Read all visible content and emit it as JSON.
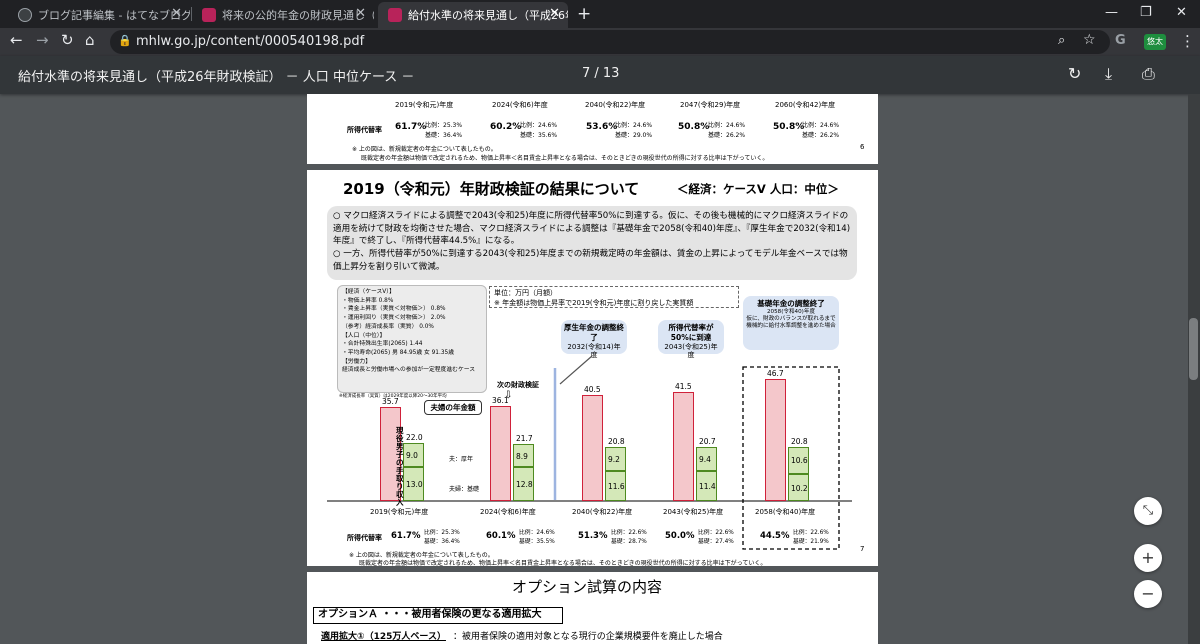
{
  "tabs": [
    {
      "title": "ブログ記事編集 - はてなブログ",
      "active": false
    },
    {
      "title": "将来の公的年金の財政見通し（財",
      "active": false
    },
    {
      "title": "給付水準の将来見通し（平成26年",
      "active": true
    }
  ],
  "new_tab": "+",
  "window": {
    "minimize": "—",
    "restore": "❐",
    "close": "✕"
  },
  "address": {
    "url": "mhlw.go.jp/content/000540198.pdf",
    "profile": "悠太"
  },
  "pdf": {
    "title": "給付水準の将来見通し（平成26年財政検証） － 人口 中位ケース －",
    "page": "7 / 13"
  },
  "prev_page": {
    "years": [
      "2019(令和元)年度",
      "2024(令和6)年度",
      "2040(令和22)年度",
      "2047(令和29)年度",
      "2060(令和42)年度"
    ],
    "label": "所得代替率",
    "rates": [
      "61.7%",
      "60.2%",
      "53.6%",
      "50.8%",
      "50.8%"
    ],
    "hirei": [
      "比例：25.3%",
      "比例：24.6%",
      "比例：24.6%",
      "比例：24.6%",
      "比例：24.6%"
    ],
    "kiso": [
      "基礎：36.4%",
      "基礎：35.6%",
      "基礎：29.0%",
      "基礎：26.2%",
      "基礎：26.2%"
    ],
    "note1": "※ 上の図は、新規裁定者の年金について表したもの。",
    "note2": "既裁定者の年金額は物価で改定されるため、物価上昇率＜名目賃金上昇率となる場合は、そのときどきの現役世代の所得に対する比率は下がっていく。",
    "num": "6"
  },
  "slide": {
    "title": "2019（令和元）年財政検証の結果について",
    "subtitle": "＜経済：ケースⅤ 人口：中位＞",
    "bullet1": "○ マクロ経済スライドによる調整で2043(令和25)年度に所得代替率50%に到達する。仮に、その後も機械的にマクロ経済スライドの適用を続けて財政を均衡させた場合、マクロ経済スライドによる調整は『基礎年金で2058(令和40)年度』、『厚生年金で2032(令和14)年度』で終了し、『所得代替率44.5%』になる。",
    "bullet2": "○ 一方、所得代替率が50%に到達する2043(令和25)年度までの新規裁定時の年金額は、賃金の上昇によってモデル年金ベースでは物価上昇分を割り引いて微減。",
    "assump": [
      "【経済（ケースⅤ）】",
      "・物価上昇率  0.8%",
      "・賃金上昇率（実質＜対物価＞） 0.8%",
      "・運用利回り（実質＜対物価＞） 2.0%",
      "（参考）経済成長率（実質） 0.0%",
      "【人口（中位）】",
      "・合計特殊出生率(2065)  1.44",
      "・平均寿命(2065) 男 84.95歳 女 91.35歳",
      "【労働力】",
      "経済成長と労働市場への参加が一定程度進むケース"
    ],
    "footnote_small": "※経済成長率（実質）は2029年度以降20～30年平均",
    "unit": "単位：万円（月額）",
    "unit_note": "※ 年金額は物価上昇率で2019(令和元)年度に割り戻した実質額",
    "callouts": [
      {
        "title": "厚生年金の調整終了",
        "sub": "2032(令和14)年度"
      },
      {
        "title": "所得代替率が50%に到達",
        "sub": "2043(令和25)年度"
      },
      {
        "title": "基礎年金の調整終了",
        "sub": "2058(令和40)年度",
        "note": "仮に、財政のバランスが取れるまで機械的に給付水準調整を進めた場合"
      }
    ],
    "next_check": "次の財政検証",
    "couple_label": "夫婦の年金額",
    "worker_label": "現役男子の手取り収入",
    "husband_label": "夫：厚年",
    "couple_kiso_label": "夫婦：基礎",
    "footer_label": "所得代替率",
    "footer_note1": "※ 上の図は、新規裁定者の年金について表したもの。",
    "footer_note2": "既裁定者の年金額は物価で改定されるため、物価上昇率＜名目賃金上昇率となる場合は、そのときどきの現役世代の所得に対する比率は下がっていく。",
    "page_num": "7"
  },
  "chart_data": {
    "type": "bar",
    "categories": [
      "2019(令和元)年度",
      "2024(令和6)年度",
      "2040(令和22)年度",
      "2043(令和25)年度",
      "2058(令和40)年度"
    ],
    "series": [
      {
        "name": "現役男子の手取り収入",
        "values": [
          35.7,
          36.1,
          40.5,
          41.5,
          46.7
        ]
      },
      {
        "name": "夫婦の年金額",
        "values": [
          22.0,
          21.7,
          20.8,
          20.7,
          20.8
        ]
      },
      {
        "name": "夫：厚年",
        "values": [
          9.0,
          8.9,
          9.2,
          9.4,
          10.6
        ]
      },
      {
        "name": "夫婦：基礎",
        "values": [
          13.0,
          12.8,
          11.6,
          11.4,
          10.2
        ]
      }
    ],
    "rates": [
      "61.7%",
      "60.1%",
      "51.3%",
      "50.0%",
      "44.5%"
    ],
    "hirei": [
      "比例：25.3%",
      "比例：24.6%",
      "比例：22.6%",
      "比例：22.6%",
      "比例：22.6%"
    ],
    "kiso": [
      "基礎：36.4%",
      "基礎：35.5%",
      "基礎：28.7%",
      "基礎：27.4%",
      "基礎：21.9%"
    ],
    "ylim": [
      0,
      50
    ]
  },
  "next_page": {
    "title": "オプション試算の内容",
    "optionA": "オプションＡ ・・・被用者保険の更なる適用拡大",
    "item1_head": "適用拡大①（125万人ベース）",
    "item1_text": "：被用者保険の適用対象となる現行の企業規模要件を廃止した場合"
  },
  "fab": {
    "fit": "⤡",
    "zoom_in": "+",
    "zoom_out": "−"
  }
}
